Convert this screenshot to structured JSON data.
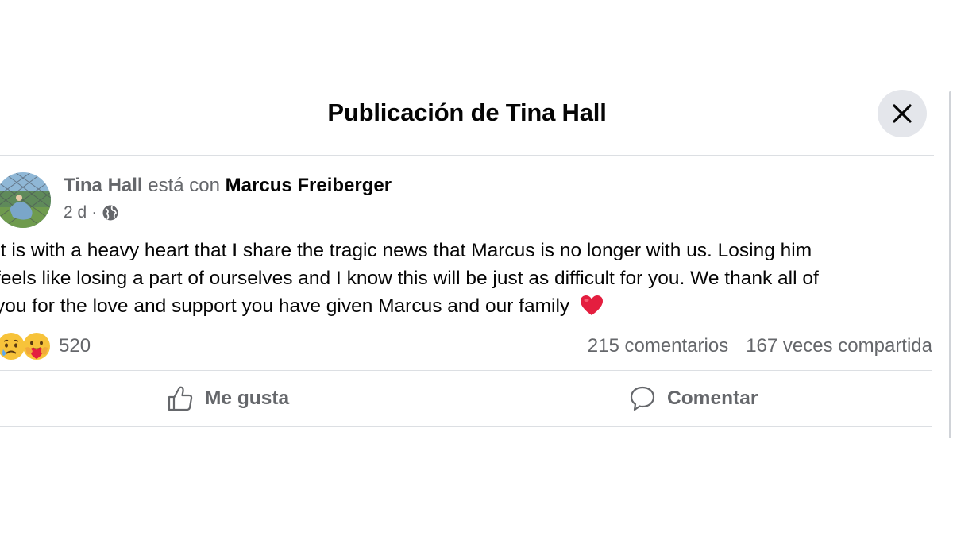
{
  "dialog": {
    "title": "Publicación de Tina Hall",
    "close_icon": "close-icon"
  },
  "post": {
    "author": "Tina Hall",
    "with_text": "está con",
    "tagged_person": "Marcus Freiberger",
    "time": "2 d",
    "separator": "·",
    "audience_icon": "globe-icon",
    "body_lines": [
      "It is with a heavy heart that I share the tragic news that Marcus is no longer with us. Losing him",
      "feels like losing a part of ourselves and I know this will be just as difficult for you. We thank all of",
      "you for the love and support you have given Marcus and our family"
    ],
    "body_emoji": "heart-emoji"
  },
  "stats": {
    "reaction_icons": [
      "sad-emoji",
      "care-emoji"
    ],
    "reactions_count": "520",
    "comments": "215 comentarios",
    "shares": "167 veces compartida"
  },
  "actions": {
    "like_label": "Me gusta",
    "comment_label": "Comentar"
  },
  "colors": {
    "secondary_text": "#65676b",
    "divider": "#dcdfe3",
    "close_bg": "#e4e6eb",
    "heart": "#e41e3f"
  }
}
